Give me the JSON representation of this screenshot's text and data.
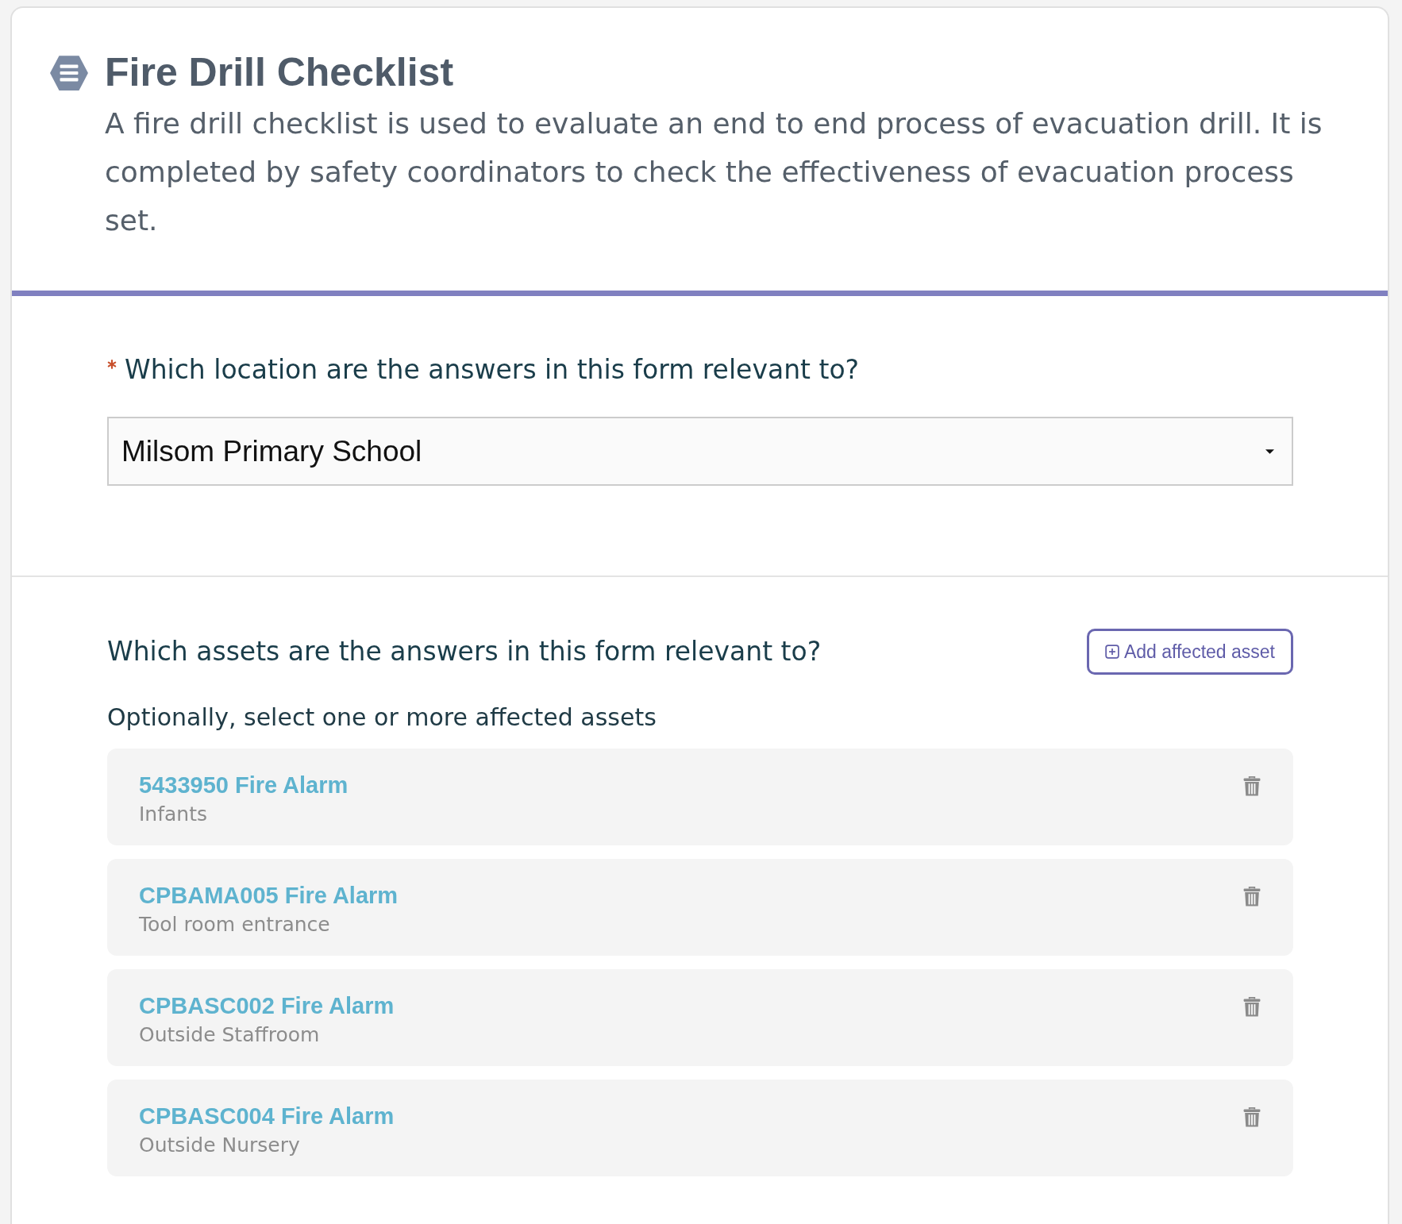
{
  "form": {
    "title": "Fire Drill Checklist",
    "description": "A fire drill checklist is used to evaluate an end to end process of evacuation drill. It is completed by safety coordinators to check the effectiveness of evacuation process set."
  },
  "location_question": {
    "required": true,
    "label": "Which location are the answers in this form relevant to?",
    "select": {
      "value": "Milsom Primary School"
    }
  },
  "assets_question": {
    "label": "Which assets are the answers in this form relevant to?",
    "add_button": "Add affected asset",
    "hint": "Optionally, select one or more affected assets",
    "assets": [
      {
        "name": "5433950 Fire Alarm",
        "location": "Infants"
      },
      {
        "name": "CPBAMA005 Fire Alarm",
        "location": "Tool room entrance"
      },
      {
        "name": "CPBASC002 Fire Alarm",
        "location": "Outside Staffroom"
      },
      {
        "name": "CPBASC004 Fire Alarm",
        "location": "Outside Nursery"
      }
    ]
  }
}
